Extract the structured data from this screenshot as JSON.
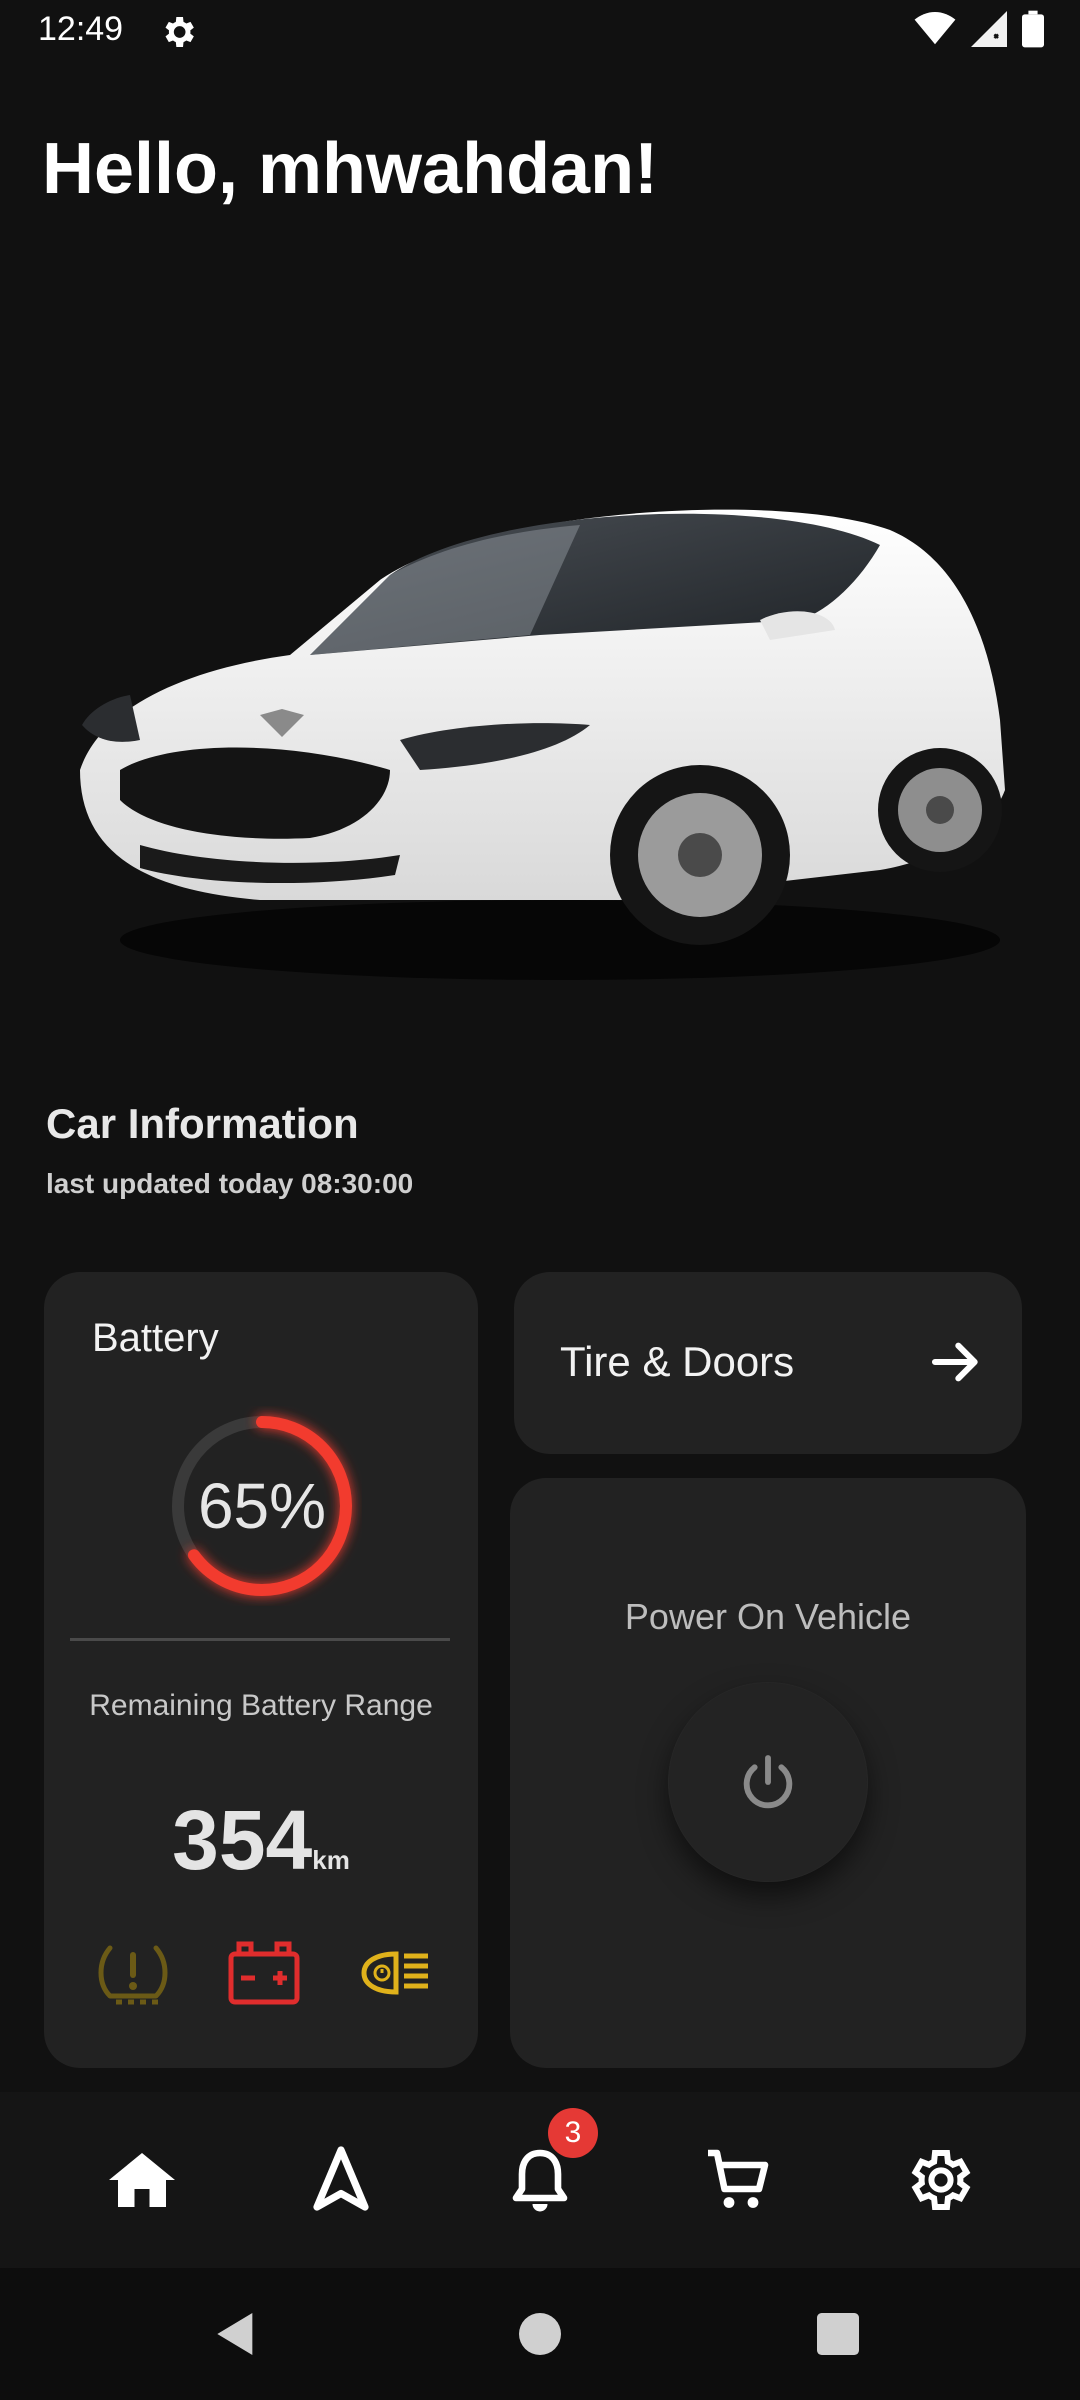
{
  "status_bar": {
    "time": "12:49",
    "icons": [
      "settings-icon",
      "wifi-icon",
      "signal-icon",
      "battery-icon"
    ]
  },
  "greeting": "Hello, mhwahdan!",
  "car_info": {
    "title": "Car Information",
    "last_updated": "last updated today 08:30:00"
  },
  "battery": {
    "title": "Battery",
    "percent_label": "65%",
    "percent_value": 65,
    "range_label": "Remaining Battery Range",
    "range_value": "354",
    "range_unit": "km",
    "ring_color": "#f23a2f",
    "warnings": [
      {
        "name": "tire-pressure-warning-icon",
        "color": "#6b5a16"
      },
      {
        "name": "battery-warning-icon",
        "color": "#e02d2d"
      },
      {
        "name": "headlight-warning-icon",
        "color": "#e0b21b"
      }
    ]
  },
  "tire_doors": {
    "label": "Tire & Doors"
  },
  "power": {
    "label": "Power On Vehicle"
  },
  "bottom_nav": {
    "items": [
      "home-icon",
      "navigation-icon",
      "notifications-icon",
      "cart-icon",
      "settings-icon"
    ],
    "notification_count": "3"
  }
}
